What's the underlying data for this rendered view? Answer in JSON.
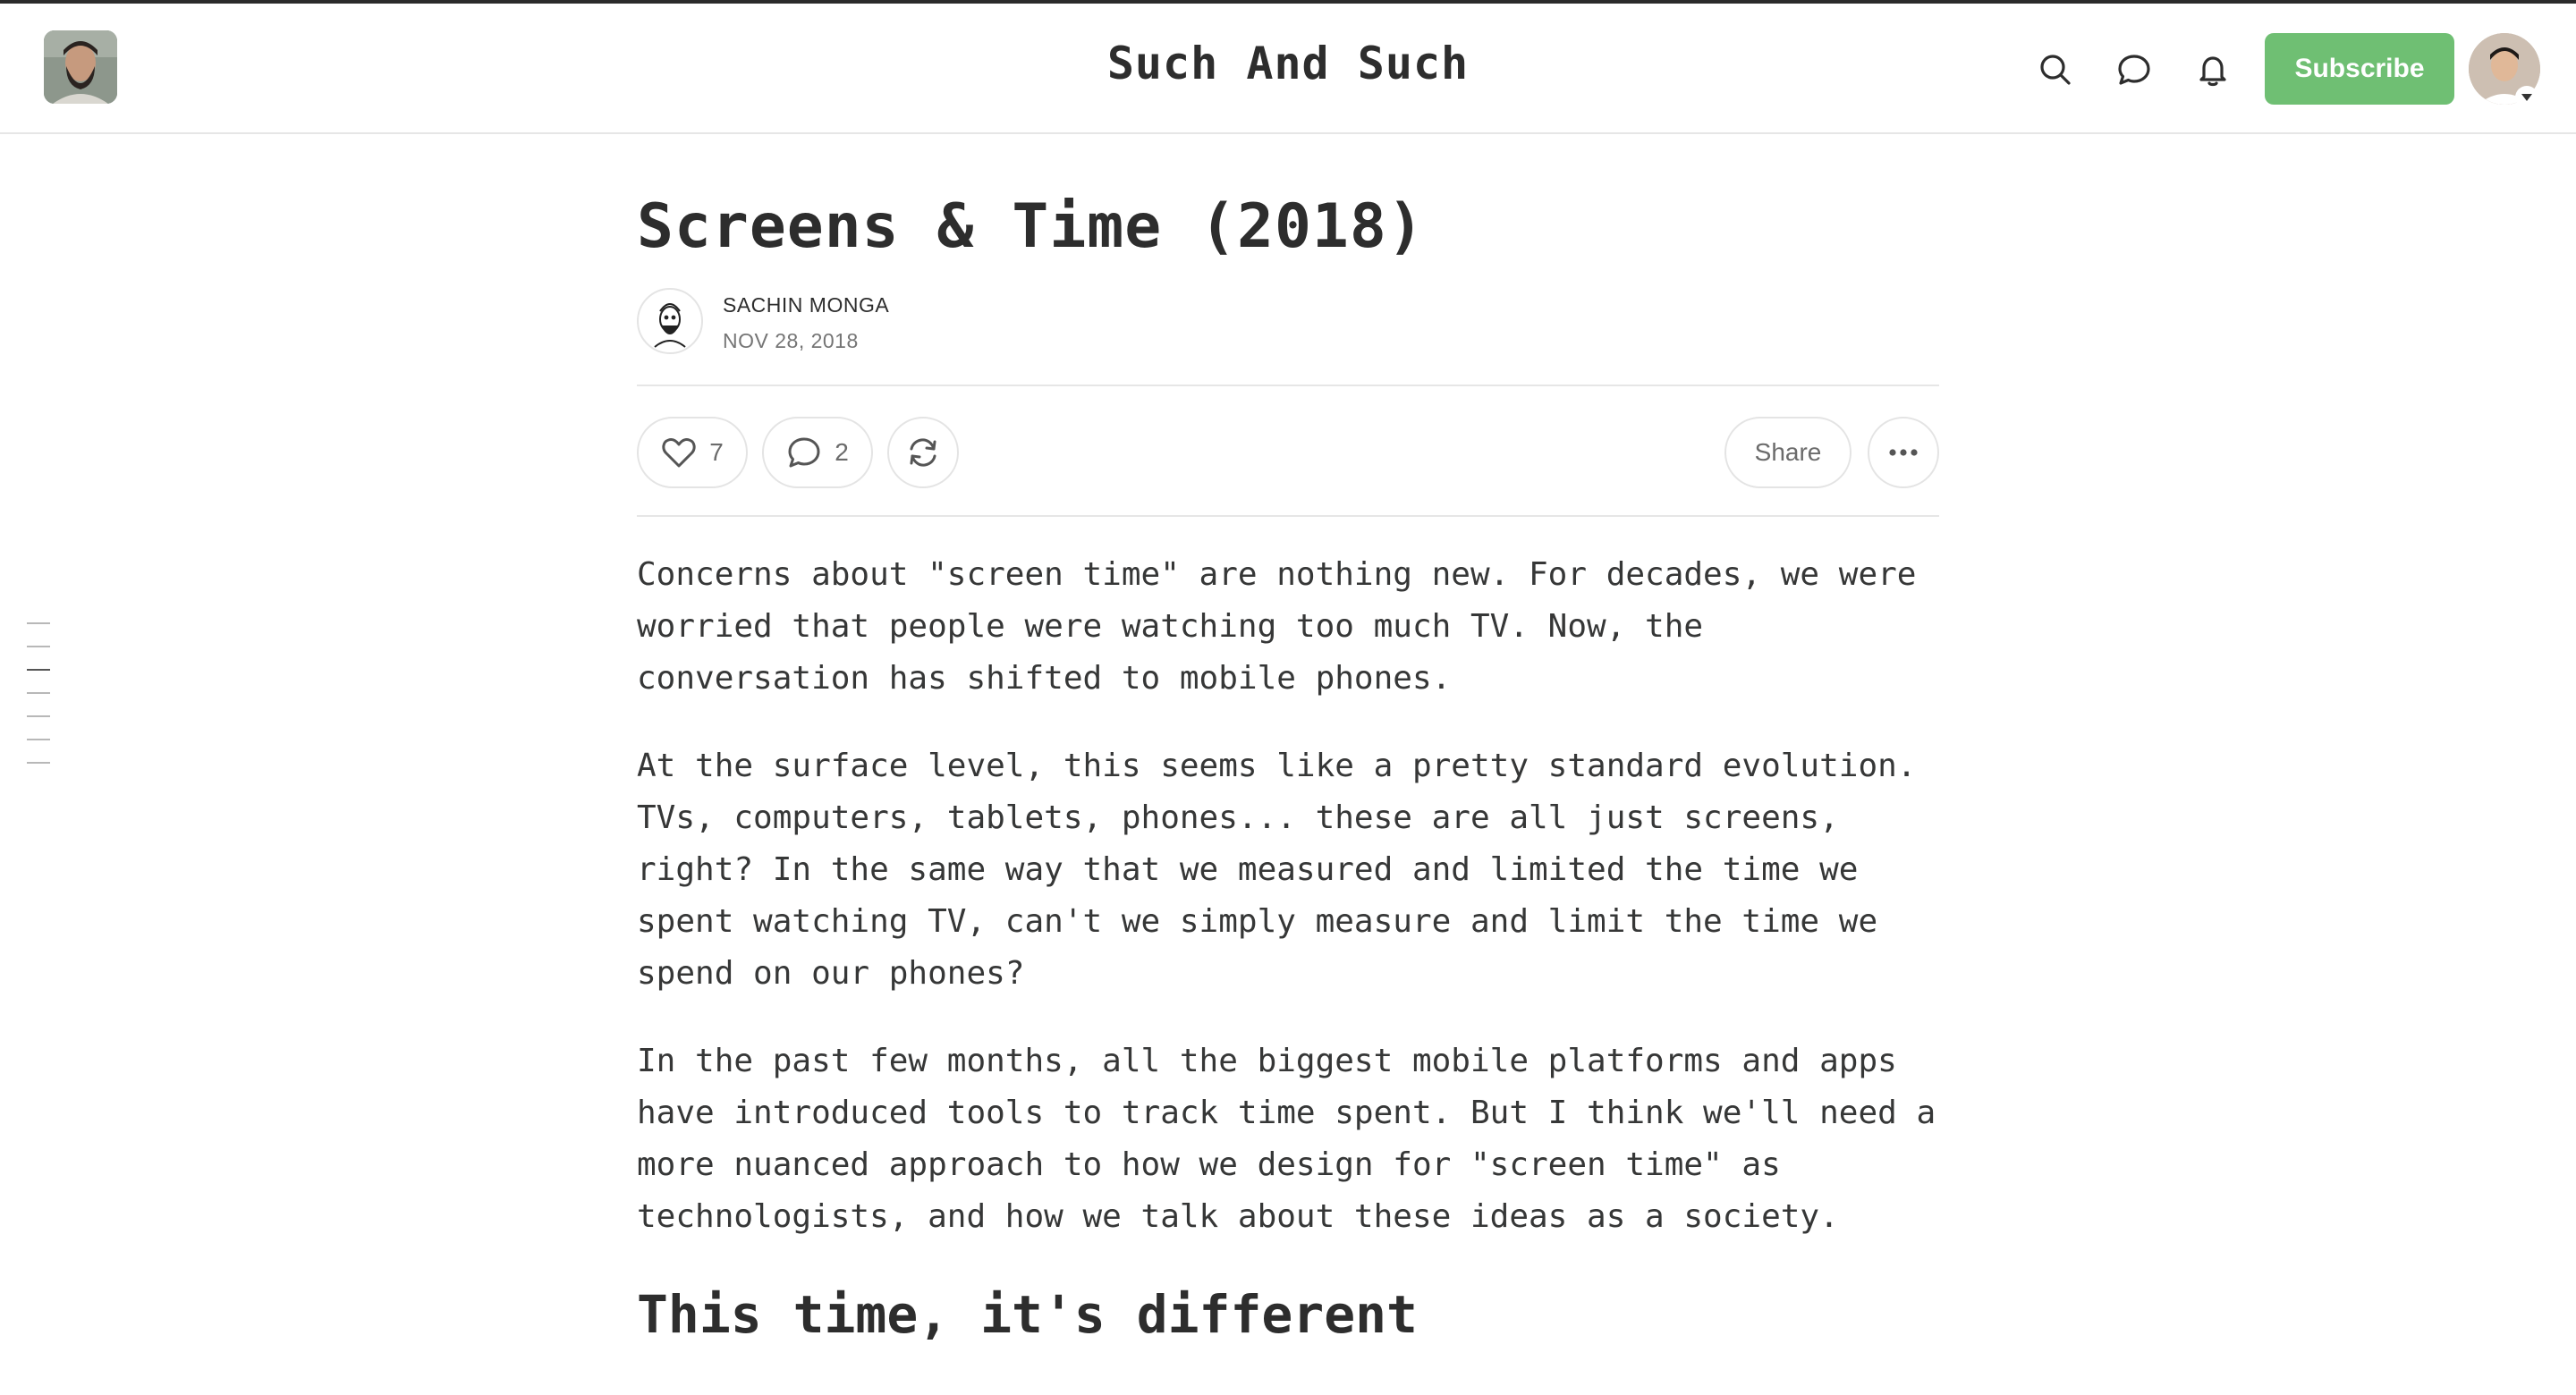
{
  "header": {
    "site_title": "Such And Such",
    "subscribe_label": "Subscribe",
    "accent_color": "#6fbf73",
    "icons": [
      "search-icon",
      "chat-icon",
      "bell-icon"
    ]
  },
  "post": {
    "title": "Screens & Time (2018)",
    "author": "SACHIN MONGA",
    "date": "NOV 28, 2018",
    "likes": "7",
    "comments": "2",
    "share_label": "Share",
    "paragraphs": [
      "Concerns about \"screen time\" are nothing new. For decades, we were worried that people were watching too much TV. Now, the conversation has shifted to mobile phones.",
      "At the surface level, this seems like a pretty standard evolution. TVs, computers, tablets, phones... these are all just screens, right? In the same way that we measured and limited the time we spent watching TV, can't we simply measure and limit the time we spend on our phones?",
      "In the past few months, all the biggest mobile platforms and apps have introduced tools to track time spent. But I think we'll need a more nuanced approach to how we design for \"screen time\" as technologists, and how we talk about these ideas as a society."
    ],
    "section_heading": "This time, it's different"
  },
  "toc": {
    "entries": 7,
    "active_index": 2
  }
}
